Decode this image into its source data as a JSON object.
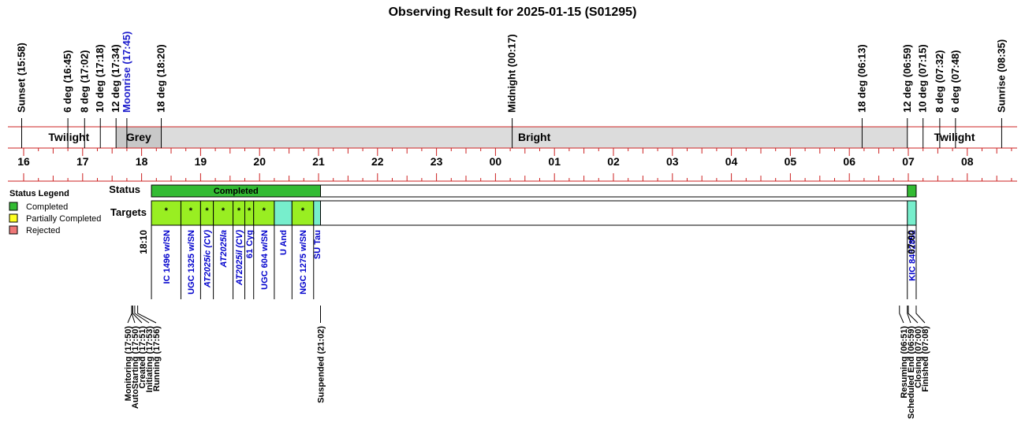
{
  "title": "Observing Result for 2025-01-15 (S01295)",
  "events": [
    {
      "label": "Sunset (15:58)",
      "time": "15:58",
      "color": "#000000"
    },
    {
      "label": "6 deg (16:45)",
      "time": "16:45",
      "color": "#000000"
    },
    {
      "label": "8 deg (17:02)",
      "time": "17:02",
      "color": "#000000"
    },
    {
      "label": "10 deg (17:18)",
      "time": "17:18",
      "color": "#000000"
    },
    {
      "label": "12 deg (17:34)",
      "time": "17:34",
      "color": "#000000"
    },
    {
      "label": "Moonrise (17:45)",
      "time": "17:45",
      "color": "#1a1acc"
    },
    {
      "label": "18 deg (18:20)",
      "time": "18:20",
      "color": "#000000"
    },
    {
      "label": "Midnight (00:17)",
      "time": "00:17",
      "color": "#000000"
    },
    {
      "label": "18 deg (06:13)",
      "time": "06:13",
      "color": "#000000"
    },
    {
      "label": "12 deg (06:59)",
      "time": "06:59",
      "color": "#000000"
    },
    {
      "label": "10 deg (07:15)",
      "time": "07:15",
      "color": "#000000"
    },
    {
      "label": "8 deg (07:32)",
      "time": "07:32",
      "color": "#000000"
    },
    {
      "label": "6 deg (07:48)",
      "time": "07:48",
      "color": "#000000"
    },
    {
      "label": "Sunrise (08:35)",
      "time": "08:35",
      "color": "#000000"
    }
  ],
  "bands": [
    {
      "label": "Twilight",
      "start": "15:58",
      "end": "17:34",
      "fill": "#ffffff"
    },
    {
      "label": "Grey",
      "start": "17:34",
      "end": "18:20",
      "fill": "#c8c8c8"
    },
    {
      "label": "Bright",
      "start": "18:20",
      "end": "06:59",
      "fill": "#dcdcdc"
    },
    {
      "label": "Twilight",
      "start": "06:59",
      "end": "08:35",
      "fill": "#ffffff"
    }
  ],
  "hours": [
    "16",
    "17",
    "18",
    "19",
    "20",
    "21",
    "22",
    "23",
    "00",
    "01",
    "02",
    "03",
    "04",
    "05",
    "06",
    "07",
    "08"
  ],
  "legend": {
    "title": "Status Legend",
    "items": [
      {
        "label": "Completed",
        "color": "#33bb33"
      },
      {
        "label": "Partially Completed",
        "color": "#ffff22"
      },
      {
        "label": "Rejected",
        "color": "#ee7777"
      }
    ]
  },
  "rows": {
    "status": "Status",
    "targets": "Targets"
  },
  "status_bars": [
    {
      "label": "Completed",
      "start": "18:10",
      "end": "21:02",
      "color": "#33bb33"
    },
    {
      "label": "",
      "start": "06:59",
      "end": "07:08",
      "color": "#33bb33"
    }
  ],
  "targets": [
    {
      "label": "IC 1496 w/SN",
      "start": "18:10",
      "end": "18:40",
      "color": "#99ee22",
      "mark": "*",
      "italic": false
    },
    {
      "label": "UGC 1325 w/SN",
      "start": "18:40",
      "end": "19:00",
      "color": "#99ee22",
      "mark": "*",
      "italic": false
    },
    {
      "label": "AT2025ic (CV)",
      "start": "19:00",
      "end": "19:13",
      "color": "#99ee22",
      "mark": "*",
      "italic": true
    },
    {
      "label": "AT2025la",
      "start": "19:13",
      "end": "19:33",
      "color": "#99ee22",
      "mark": "*",
      "italic": true
    },
    {
      "label": "AT2025il (CV)",
      "start": "19:33",
      "end": "19:45",
      "color": "#99ee22",
      "mark": "*",
      "italic": true
    },
    {
      "label": "61 Cyg",
      "start": "19:45",
      "end": "19:54",
      "color": "#99ee22",
      "mark": "*",
      "italic": false
    },
    {
      "label": "UGC 604 w/SN",
      "start": "19:54",
      "end": "20:15",
      "color": "#99ee22",
      "mark": "*",
      "italic": false
    },
    {
      "label": "U And",
      "start": "20:15",
      "end": "20:33",
      "color": "#77eecc",
      "mark": "",
      "italic": false
    },
    {
      "label": "NGC 1275 w/SN",
      "start": "20:33",
      "end": "20:55",
      "color": "#99ee22",
      "mark": "*",
      "italic": false
    },
    {
      "label": "SU Tau",
      "start": "20:55",
      "end": "21:02",
      "color": "#77eecc",
      "mark": "",
      "italic": false
    },
    {
      "label": "KIC 8462852",
      "start": "06:59",
      "end": "07:08",
      "color": "#77eecc",
      "mark": "",
      "italic": false
    }
  ],
  "timestamps": [
    {
      "label": "18:10",
      "time": "18:10"
    },
    {
      "label": "07:00",
      "time": "07:00"
    }
  ],
  "logs_left": [
    {
      "label": "Monitoring (17:50)",
      "time": "17:50"
    },
    {
      "label": "AutoStarting (17:50)",
      "time": "17:50"
    },
    {
      "label": "Created (17:51)",
      "time": "17:51"
    },
    {
      "label": "Initiating (17:53)",
      "time": "17:53"
    },
    {
      "label": "Running (17:56)",
      "time": "17:56"
    }
  ],
  "log_suspended": {
    "label": "Suspended (21:02)",
    "time": "21:02",
    "color": "#ff8800"
  },
  "logs_right": [
    {
      "label": "Resuming (06:51)",
      "time": "06:51"
    },
    {
      "label": "Scheduled End (06:59)",
      "time": "06:59"
    },
    {
      "label": "Closing (07:00)",
      "time": "07:00"
    },
    {
      "label": "Finished (07:08)",
      "time": "07:08"
    }
  ]
}
